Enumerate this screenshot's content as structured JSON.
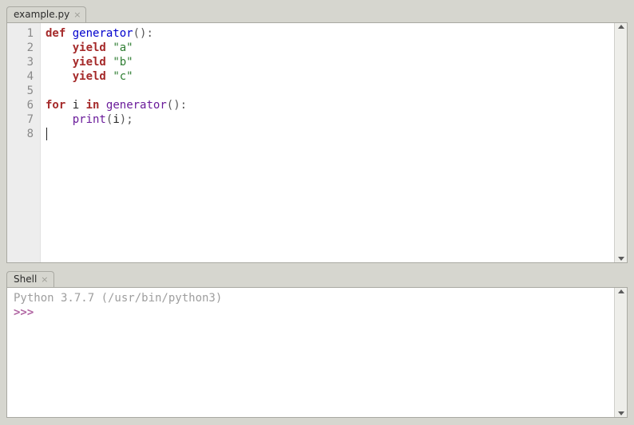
{
  "editor": {
    "tab_label": "example.py",
    "line_numbers": [
      "1",
      "2",
      "3",
      "4",
      "5",
      "6",
      "7",
      "8"
    ],
    "code": {
      "l1": {
        "kw_def": "def",
        "name": "generator",
        "paren_open": "(",
        "paren_close": ")",
        "colon": ":"
      },
      "l2": {
        "kw_yield": "yield",
        "str": "\"a\""
      },
      "l3": {
        "kw_yield": "yield",
        "str": "\"b\""
      },
      "l4": {
        "kw_yield": "yield",
        "str": "\"c\""
      },
      "l5": "",
      "l6": {
        "kw_for": "for",
        "var": "i",
        "kw_in": "in",
        "call": "generator",
        "paren_open": "(",
        "paren_close": ")",
        "colon": ":"
      },
      "l7": {
        "call": "print",
        "paren_open": "(",
        "arg": "i",
        "paren_close": ")",
        "semi": ";"
      },
      "l8": ""
    }
  },
  "shell": {
    "tab_label": "Shell",
    "banner": "Python 3.7.7 (/usr/bin/python3)",
    "prompt": ">>> "
  }
}
